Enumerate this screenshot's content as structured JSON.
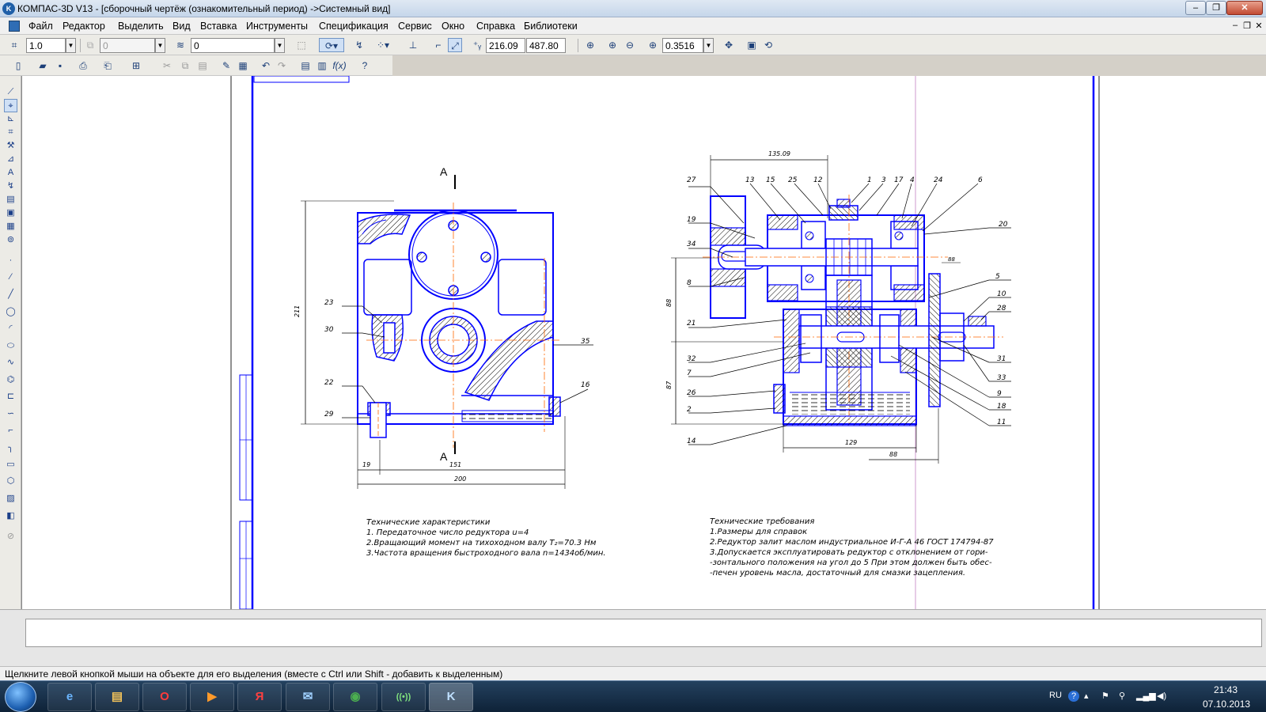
{
  "window": {
    "title": "КОМПАС-3D V13 - [сборочный чертёж (ознакомительный период) ->Системный вид]",
    "app_icon": "kompas-logo-icon",
    "controls": {
      "minimize": "‒",
      "maximize": "❐",
      "close": "✕"
    }
  },
  "menu": {
    "items": [
      "Файл",
      "Редактор",
      "Выделить",
      "Вид",
      "Вставка",
      "Инструменты",
      "Спецификация",
      "Сервис",
      "Окно",
      "Справка",
      "Библиотеки"
    ],
    "mdi_controls": [
      "‒",
      "❐",
      "✕"
    ]
  },
  "toolbar1": {
    "scale_value": "1.0",
    "layer_value": "0",
    "style_value": "0",
    "coord_x": "216.09",
    "coord_y": "487.80",
    "zoom_value": "0.3516"
  },
  "drawing": {
    "left_view": {
      "section_label_top": "A",
      "section_label_bottom": "A",
      "dim_height": "211",
      "dim_19": "19",
      "dim_151": "151",
      "dim_200": "200",
      "callouts": [
        "23",
        "30",
        "22",
        "29",
        "35",
        "16"
      ]
    },
    "right_view": {
      "dim_top": "135.09",
      "dim_88_left": "88",
      "dim_87": "87",
      "dim_129": "129",
      "dim_88_bottom": "88",
      "dim_88_right": "88",
      "callouts_left": [
        "27",
        "19",
        "34",
        "8",
        "21",
        "32",
        "7",
        "26",
        "2",
        "14"
      ],
      "callouts_top": [
        "13",
        "15",
        "25",
        "12",
        "1",
        "3",
        "17",
        "4",
        "24",
        "6"
      ],
      "callouts_right": [
        "20",
        "5",
        "10",
        "28",
        "31",
        "33",
        "9",
        "18",
        "11"
      ]
    },
    "tech_characteristics": {
      "title": "Технические характеристики",
      "lines": [
        "1. Передаточное число редуктора u=4",
        "2.Вращающий момент на тихоходном валу T₂=70.3 Нм",
        "3.Частота вращения быстроходного вала n=1434об/мин."
      ]
    },
    "tech_requirements": {
      "title": "Технические требования",
      "lines": [
        "1.Размеры для справок",
        "2.Редуктор залит маслом индустриальное И-Г-А 46 ГОСТ 174794-87",
        "3.Допускается эксплуатировать редуктор с отклонением от гори-",
        "-зонтального положения на угол до 5 При этом должен быть обес-",
        "-печен уровень масла, достаточный для смазки зацепления."
      ]
    },
    "colors": {
      "outline": "#0000ff",
      "hatch": "#000000",
      "center_line": "#ff6600",
      "frame": "#000080",
      "guide": "#cc99cc"
    }
  },
  "status": {
    "hint": "Щелкните левой кнопкой мыши на объекте для его выделения (вместе с Ctrl или Shift - добавить к выделенным)"
  },
  "taskbar": {
    "apps": [
      {
        "name": "internet-explorer",
        "glyph": "e"
      },
      {
        "name": "file-explorer",
        "glyph": "▤"
      },
      {
        "name": "opera",
        "glyph": "O"
      },
      {
        "name": "media-player",
        "glyph": "▶"
      },
      {
        "name": "yandex",
        "glyph": "Я"
      },
      {
        "name": "mail",
        "glyph": "✉"
      },
      {
        "name": "chrome",
        "glyph": "◉"
      },
      {
        "name": "network-app",
        "glyph": "((•))"
      },
      {
        "name": "kompas",
        "glyph": "K"
      }
    ],
    "lang": "RU",
    "time": "21:43",
    "date": "07.10.2013"
  }
}
